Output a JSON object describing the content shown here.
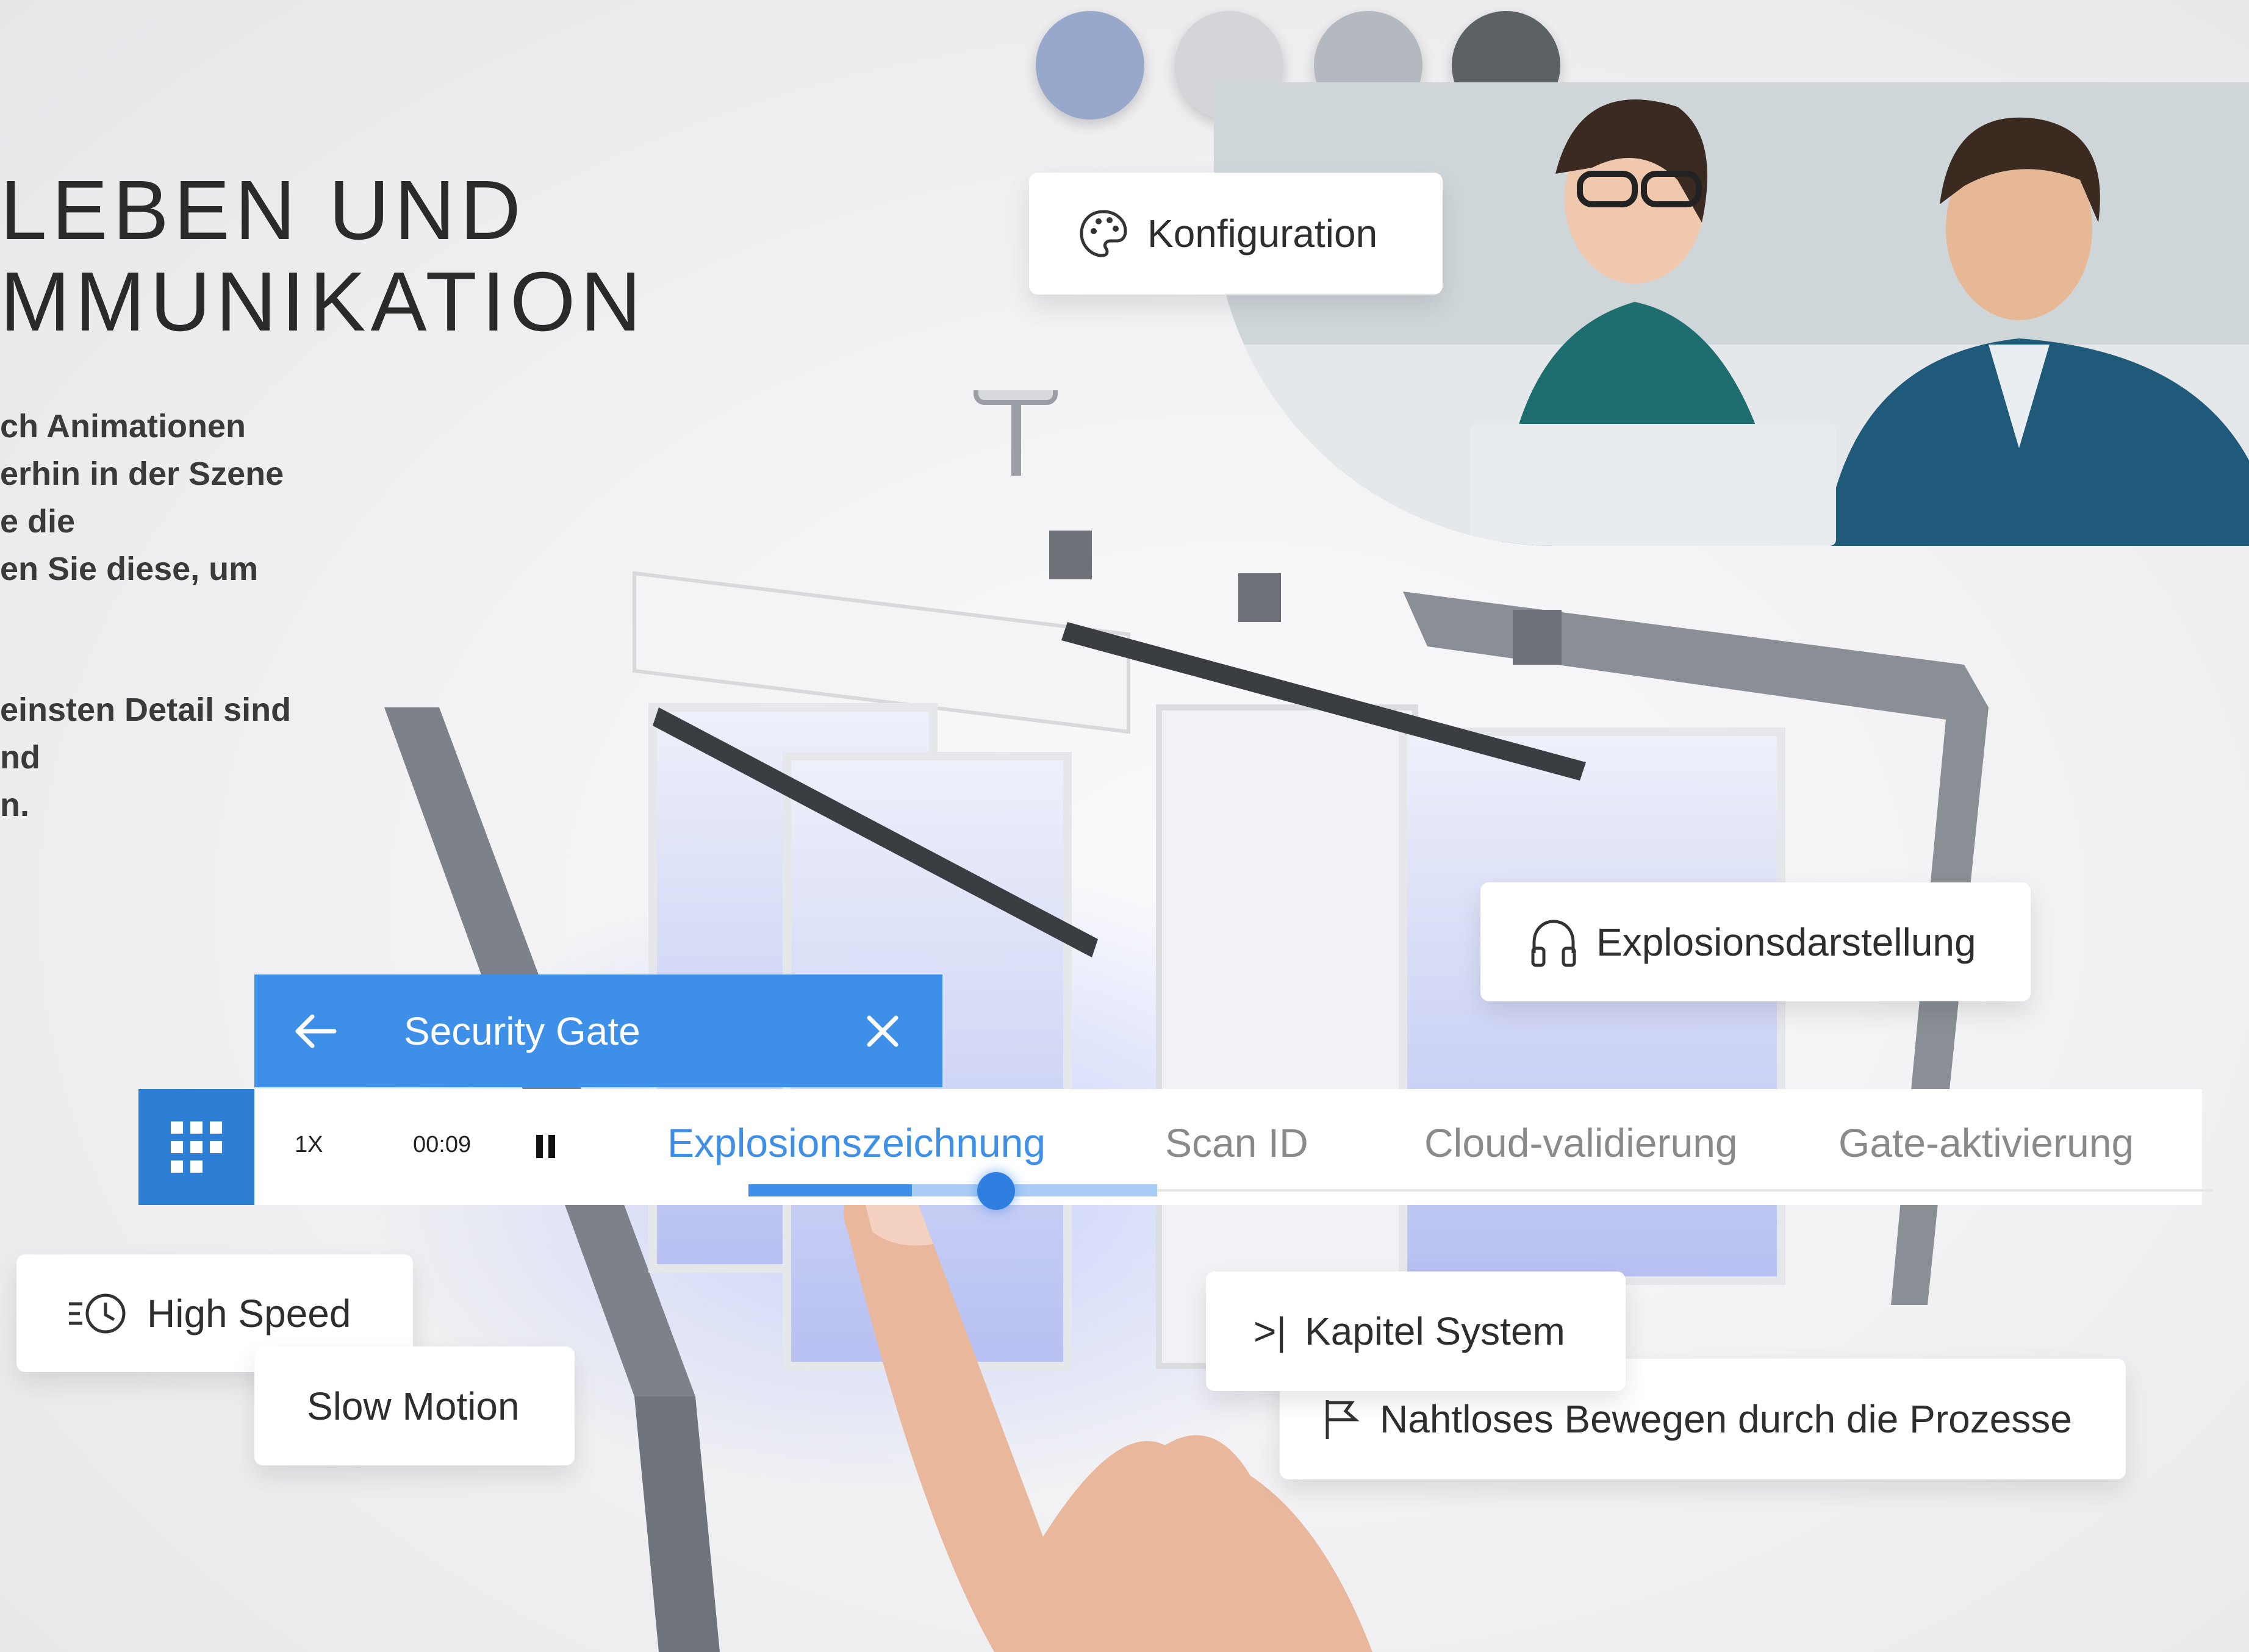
{
  "heading": {
    "line1": "LEBEN UND",
    "line2": "MMUNIKATION"
  },
  "paragraph": {
    "lines1": [
      "ch Animationen",
      "erhin in der Szene",
      "e die",
      "en Sie diese, um"
    ],
    "lines2": [
      "einsten Detail sind",
      "nd",
      "n."
    ]
  },
  "swatches": [
    "#97a8cb",
    "#d3d5d9",
    "#b3b9be",
    "#5c6166"
  ],
  "cards": {
    "konfiguration": "Konfiguration",
    "explosionsdarstellung": "Explosionsdarstellung",
    "high_speed": "High Speed",
    "slow_motion": "Slow Motion",
    "kapitel_system": "Kapitel System",
    "nahtloses": "Nahtloses Bewegen durch die Prozesse"
  },
  "kapitel_prefix": ">|",
  "player": {
    "title": "Security Gate",
    "speed": "1X",
    "time": "00:09",
    "tabs": [
      "Explosionszeichnung",
      "Scan ID",
      "Cloud-validierung",
      "Gate-aktivierung"
    ],
    "active_tab": 0,
    "progress": 0.4
  },
  "colors": {
    "accent": "#3d8fe8",
    "accent_dark": "#2d7fd6"
  }
}
